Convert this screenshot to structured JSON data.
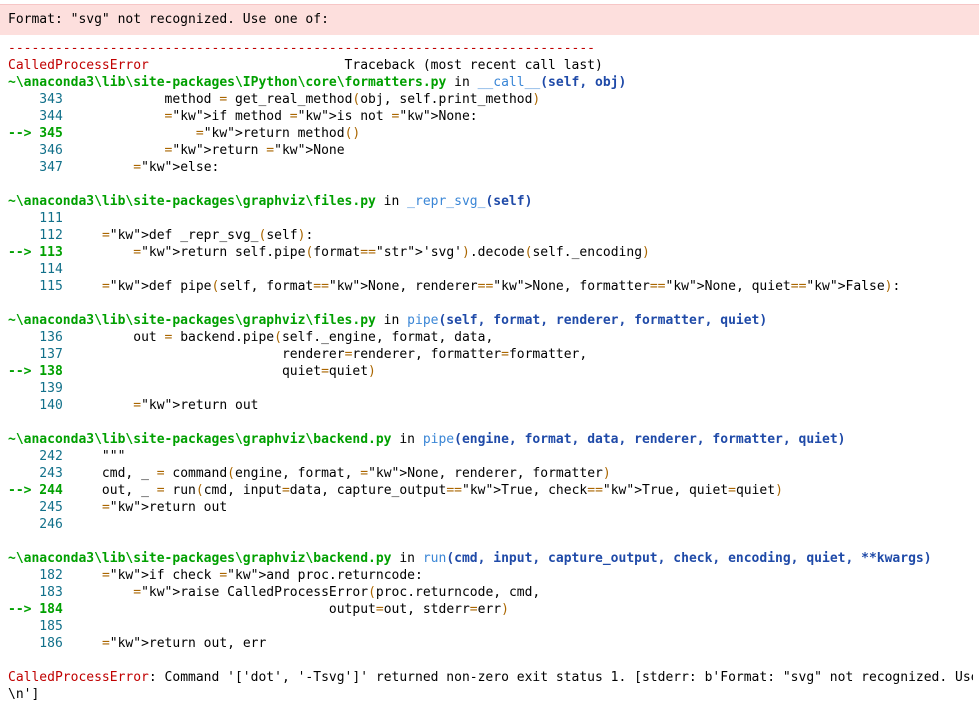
{
  "banner": "Format: \"svg\" not recognized. Use one of:",
  "separator": "---------------------------------------------------------------------------",
  "error_name": "CalledProcessError",
  "traceback_header": "                         Traceback (most recent call last)",
  "frames": [
    {
      "path": "~\\anaconda3\\lib\\site-packages\\IPython\\core\\formatters.py",
      "in_text": " in ",
      "func": "__call__",
      "args": "(self, obj)",
      "lines": [
        {
          "ln": "    343 ",
          "code": "            method = get_real_method(obj, self.print_method)",
          "cur": false
        },
        {
          "ln": "    344 ",
          "code": "            if method is not None:",
          "cur": false
        },
        {
          "ln": "--> 345 ",
          "code": "                return method()",
          "cur": true
        },
        {
          "ln": "    346 ",
          "code": "            return None",
          "cur": false
        },
        {
          "ln": "    347 ",
          "code": "        else:",
          "cur": false
        }
      ]
    },
    {
      "path": "~\\anaconda3\\lib\\site-packages\\graphviz\\files.py",
      "in_text": " in ",
      "func": "_repr_svg_",
      "args": "(self)",
      "lines": [
        {
          "ln": "    111 ",
          "code": "",
          "cur": false
        },
        {
          "ln": "    112 ",
          "code": "    def _repr_svg_(self):",
          "cur": false
        },
        {
          "ln": "--> 113 ",
          "code": "        return self.pipe(format='svg').decode(self._encoding)",
          "cur": true
        },
        {
          "ln": "    114 ",
          "code": "",
          "cur": false
        },
        {
          "ln": "    115 ",
          "code": "    def pipe(self, format=None, renderer=None, formatter=None, quiet=False):",
          "cur": false
        }
      ]
    },
    {
      "path": "~\\anaconda3\\lib\\site-packages\\graphviz\\files.py",
      "in_text": " in ",
      "func": "pipe",
      "args": "(self, format, renderer, formatter, quiet)",
      "lines": [
        {
          "ln": "    136 ",
          "code": "        out = backend.pipe(self._engine, format, data,",
          "cur": false
        },
        {
          "ln": "    137 ",
          "code": "                           renderer=renderer, formatter=formatter,",
          "cur": false
        },
        {
          "ln": "--> 138 ",
          "code": "                           quiet=quiet)",
          "cur": true
        },
        {
          "ln": "    139 ",
          "code": "",
          "cur": false
        },
        {
          "ln": "    140 ",
          "code": "        return out",
          "cur": false
        }
      ]
    },
    {
      "path": "~\\anaconda3\\lib\\site-packages\\graphviz\\backend.py",
      "in_text": " in ",
      "func": "pipe",
      "args": "(engine, format, data, renderer, formatter, quiet)",
      "lines": [
        {
          "ln": "    242 ",
          "code": "    \"\"\"",
          "cur": false
        },
        {
          "ln": "    243 ",
          "code": "    cmd, _ = command(engine, format, None, renderer, formatter)",
          "cur": false
        },
        {
          "ln": "--> 244 ",
          "code": "    out, _ = run(cmd, input=data, capture_output=True, check=True, quiet=quiet)",
          "cur": true
        },
        {
          "ln": "    245 ",
          "code": "    return out",
          "cur": false
        },
        {
          "ln": "    246 ",
          "code": "",
          "cur": false
        }
      ]
    },
    {
      "path": "~\\anaconda3\\lib\\site-packages\\graphviz\\backend.py",
      "in_text": " in ",
      "func": "run",
      "args": "(cmd, input, capture_output, check, encoding, quiet, **kwargs)",
      "lines": [
        {
          "ln": "    182 ",
          "code": "    if check and proc.returncode:",
          "cur": false
        },
        {
          "ln": "    183 ",
          "code": "        raise CalledProcessError(proc.returncode, cmd,",
          "cur": false
        },
        {
          "ln": "--> 184 ",
          "code": "                                 output=out, stderr=err)",
          "cur": true
        },
        {
          "ln": "    185 ",
          "code": "",
          "cur": false
        },
        {
          "ln": "    186 ",
          "code": "    return out, err",
          "cur": false
        }
      ]
    }
  ],
  "final_error": {
    "name": "CalledProcessError",
    "message": ": Command '['dot', '-Tsvg']' returned non-zero exit status 1. [stderr: b'Format: \"svg\" not recognized. Use one of:\\r",
    "message_line2": "\\n']"
  }
}
